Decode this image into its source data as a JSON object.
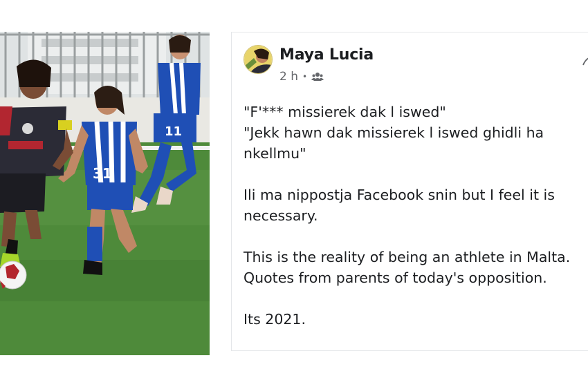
{
  "post": {
    "author": "Maya Lucia",
    "time": "2 h",
    "separator": "•",
    "audience_icon": "friends-icon",
    "paragraphs": [
      [
        "\"F'*** missierek dak l iswed\"",
        "\"Jekk hawn dak missierek l iswed ghidli ha nkellmu\""
      ],
      [
        "Ili ma nippostja Facebook snin but I feel it is necessary."
      ],
      [
        "This is the reality of being an athlete in Malta.",
        "Quotes from parents of today's opposition."
      ],
      [
        "Its 2021."
      ]
    ]
  },
  "photo": {
    "jersey_numbers": [
      "31",
      "11"
    ]
  },
  "colors": {
    "name_text": "#1c1e21",
    "meta_text": "#65676b",
    "home_kit": "#1f4fb5",
    "away_kit": "#2b2b36",
    "pitch": "#4e8a3a"
  }
}
